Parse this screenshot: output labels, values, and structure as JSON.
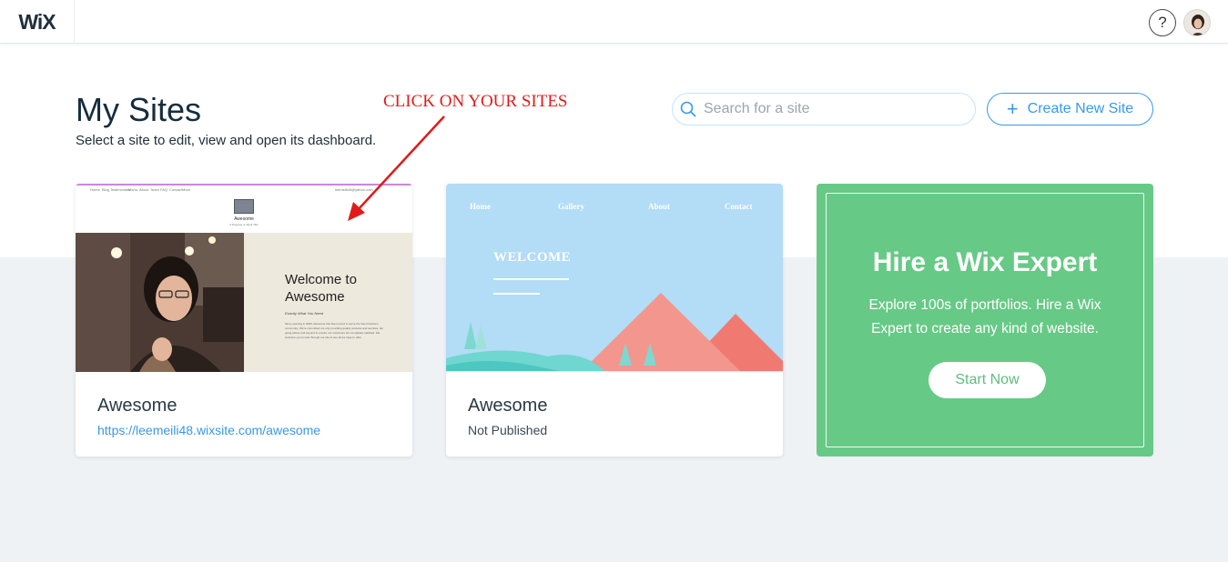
{
  "topbar": {
    "logo": "WiX",
    "help_label": "?"
  },
  "header": {
    "title": "My Sites",
    "subtitle": "Select a site to edit, view and open its dashboard.",
    "annotation": "CLICK ON YOUR SITES"
  },
  "search": {
    "placeholder": "Search for a site",
    "value": ""
  },
  "create": {
    "plus": "+",
    "label": "Create New Site"
  },
  "sites": [
    {
      "name": "Awesome",
      "url": "https://leemeili48.wixsite.com/awesome",
      "thumb": {
        "nav_items": [
          "Home",
          "Blog",
          "Testimonials",
          "Menu",
          "About",
          "Team",
          "FAQ",
          "Contact",
          "More"
        ],
        "email": "leemeili48@yahoo.com",
        "site_name": "Awesome",
        "tagline": "A Purpose or Work Title",
        "welcome": "Welcome to Awesome",
        "sub": "Exactly What You Need",
        "paragraph": "Since opening in 2000, Awesome has been proud to serve the San Francisco community. We're committed not only providing quality products and services, but going above and beyond to ensure our customers are completely satisfied. We welcome you to look through our site to see all we have to offer."
      }
    },
    {
      "name": "Awesome",
      "status": "Not Published",
      "thumb": {
        "nav_items": [
          "Home",
          "Gallery",
          "About",
          "Contact"
        ],
        "welcome": "WELCOME"
      }
    }
  ],
  "expert": {
    "title": "Hire a Wix Expert",
    "text": "Explore 100s of portfolios. Hire a Wix Expert to create any kind of website.",
    "button": "Start Now"
  },
  "colors": {
    "accent": "#3899ec",
    "expert_green": "#67c986",
    "annotation_red": "#e11b1b",
    "background": "#eff2f5"
  }
}
